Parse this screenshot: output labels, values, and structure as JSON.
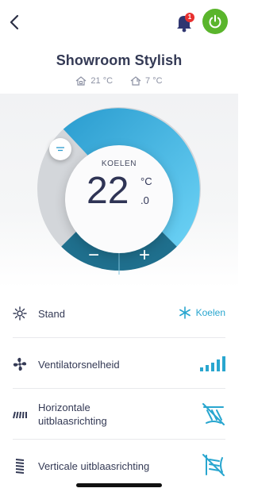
{
  "header": {
    "title": "Showroom Stylish",
    "notification_count": "1",
    "indoor_temp": "21 °C",
    "outdoor_temp": "7 °C"
  },
  "dial": {
    "mode": "KOELEN",
    "temp_integer": "22",
    "temp_unit": "°C",
    "temp_decimal": ".0",
    "minus_label": "−",
    "plus_label": "+"
  },
  "settings": [
    {
      "label": "Stand",
      "value": "Koelen",
      "icon": "mode-icon"
    },
    {
      "label": "Ventilatorsnelheid",
      "value": "",
      "icon": "fan-icon"
    },
    {
      "label": "Horizontale uitblaasrichting",
      "value": "",
      "icon": "horizontal-louver-icon"
    },
    {
      "label": "Verticale uitblaasrichting",
      "value": "",
      "icon": "vertical-louver-icon"
    }
  ],
  "colors": {
    "accent": "#29a6cf",
    "power": "#5ab52c",
    "badge": "#e8302f",
    "dial_dark": "#1f6f8d",
    "dial_light": "#5fcbf3"
  }
}
